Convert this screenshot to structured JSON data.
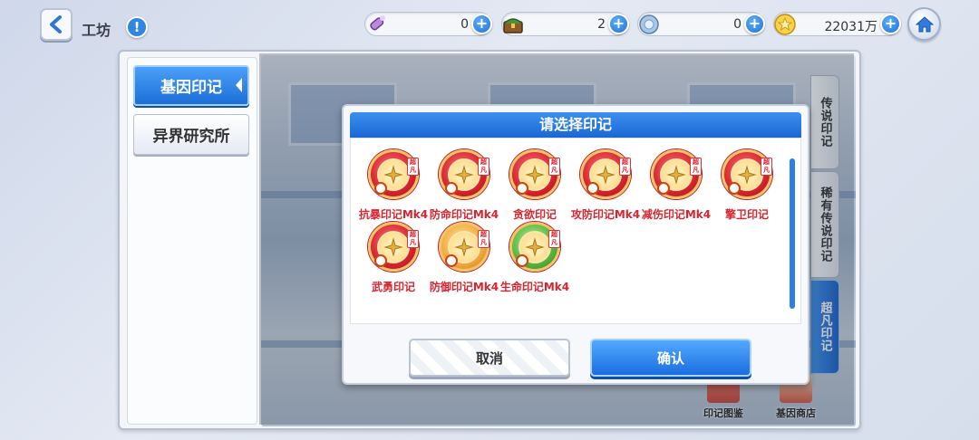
{
  "header": {
    "title": "工坊",
    "info_icon": "!",
    "currencies": [
      {
        "name": "potion",
        "icon": "potion-icon",
        "value": "0"
      },
      {
        "name": "chest",
        "icon": "chest-icon",
        "value": "2"
      },
      {
        "name": "orb",
        "icon": "orb-icon",
        "value": "0"
      },
      {
        "name": "gold",
        "icon": "star-coin-icon",
        "value": "22031万"
      }
    ],
    "plus_label": "+"
  },
  "left_nav": {
    "items": [
      {
        "label": "基因印记",
        "active": true
      },
      {
        "label": "异界研究所",
        "active": false
      }
    ]
  },
  "right_tabs": [
    {
      "label": "传说印记",
      "active": false
    },
    {
      "label": "稀有传说印记",
      "active": false
    },
    {
      "label": "超凡印记",
      "active": true
    }
  ],
  "shortcuts": [
    {
      "label": "印记图鉴",
      "icon": "catalog-icon"
    },
    {
      "label": "基因商店",
      "icon": "shop-icon"
    }
  ],
  "dialog": {
    "title": "请选择印记",
    "tag_text": "超凡",
    "marks": [
      {
        "name": "抗暴印记Mk4",
        "icon": "riot-icon",
        "style": "red"
      },
      {
        "name": "防命印记Mk4",
        "icon": "cross-icon",
        "style": "red"
      },
      {
        "name": "贪欲印记",
        "icon": "wing-icon",
        "style": "red"
      },
      {
        "name": "攻防印记Mk4",
        "icon": "sword-icon",
        "style": "red"
      },
      {
        "name": "减伤印记Mk4",
        "icon": "down-arrow-icon",
        "style": "red"
      },
      {
        "name": "擎卫印记",
        "icon": "guard-icon",
        "style": "red"
      },
      {
        "name": "武勇印记",
        "icon": "warrior-icon",
        "style": "red"
      },
      {
        "name": "防御印记Mk4",
        "icon": "shield-icon",
        "style": "gold"
      },
      {
        "name": "生命印记Mk4",
        "icon": "life-cross-icon",
        "style": "green"
      }
    ],
    "cancel_label": "取消",
    "confirm_label": "确认"
  }
}
